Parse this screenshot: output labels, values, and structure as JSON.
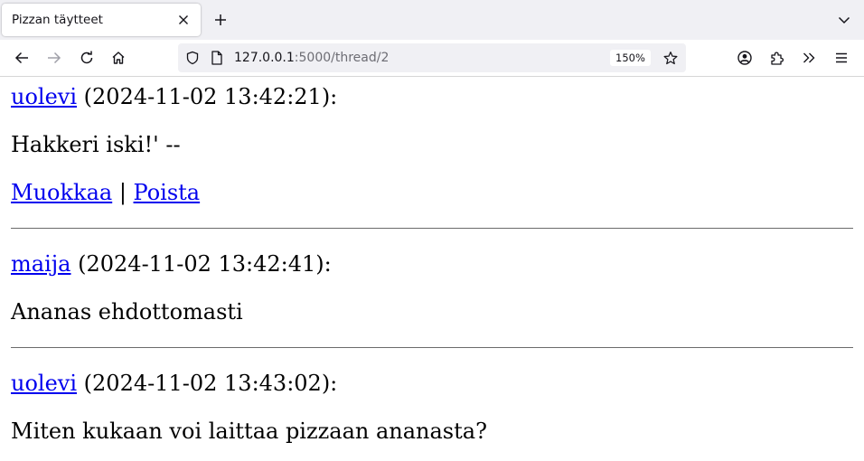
{
  "tab": {
    "title": "Pizzan täytteet",
    "close_icon": "close-icon",
    "new_tab_icon": "plus-icon",
    "list_tabs_icon": "chevron-down-icon"
  },
  "toolbar": {
    "back_icon": "arrow-left-icon",
    "forward_icon": "arrow-right-icon",
    "reload_icon": "reload-icon",
    "home_icon": "home-icon",
    "account_icon": "account-icon",
    "extensions_icon": "puzzle-icon",
    "overflow_icon": "double-chevron-icon",
    "menu_icon": "hamburger-icon"
  },
  "urlbar": {
    "host": "127.0.0.1",
    "rest": ":5000/thread/2",
    "zoom": "150%",
    "shield_icon": "tracking-shield-icon",
    "page_icon": "page-icon",
    "bookmark_icon": "star-icon"
  },
  "messages": [
    {
      "username": "uolevi",
      "timestamp": " (2024-11-02 13:42:21):",
      "content": "Hakkeri iski!' --",
      "edit_label": "Muokkaa",
      "separator": " | ",
      "delete_label": "Poista"
    },
    {
      "username": "maija",
      "timestamp": " (2024-11-02 13:42:41):",
      "content": "Ananas ehdottomasti"
    },
    {
      "username": "uolevi",
      "timestamp": " (2024-11-02 13:43:02):",
      "content": "Miten kukaan voi laittaa pizzaan ananasta?"
    }
  ]
}
